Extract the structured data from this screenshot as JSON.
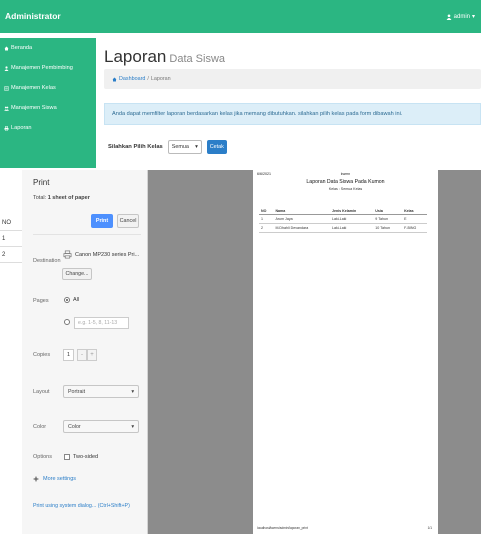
{
  "navbar": {
    "brand": "Administrator",
    "user": "admin",
    "bg_color": "#2bb682"
  },
  "sidebar": {
    "items": [
      {
        "label": "Beranda",
        "icon": "home-icon"
      },
      {
        "label": "Manajemen Pembimbing",
        "icon": "user-icon"
      },
      {
        "label": "Manajemen Kelas",
        "icon": "list-icon"
      },
      {
        "label": "Manajemen Siswa",
        "icon": "users-icon"
      },
      {
        "label": "Laporan",
        "icon": "print-icon"
      }
    ]
  },
  "main": {
    "title": "Laporan",
    "subtitle": "Data Siswa",
    "breadcrumb": {
      "home": "Dashboard",
      "separator": "/",
      "current": "Laporan"
    },
    "alert": "Anda dapat memfilter laporan berdasarkan kelas jika memang dibutuhkan. silahkan pilih kelas pada form dibawah ini.",
    "filter": {
      "label": "Silahkan Pilih Kelas",
      "selected": "Semua",
      "button": "Cetak"
    }
  },
  "background_table": {
    "header": "NO",
    "rows": [
      "1",
      "2"
    ]
  },
  "print": {
    "title": "Print",
    "total_prefix": "Total:",
    "total_value": "1 sheet of paper",
    "print_button": "Print",
    "cancel_button": "Cancel",
    "destination_label": "Destination",
    "destination_value": "Canon MP230 series Pri...",
    "change_button": "Change...",
    "pages_label": "Pages",
    "pages_all": "All",
    "pages_placeholder": "e.g. 1-5, 8, 11-13",
    "copies_label": "Copies",
    "copies_value": "1",
    "copies_minus": "-",
    "copies_plus": "+",
    "layout_label": "Layout",
    "layout_value": "Portrait",
    "color_label": "Color",
    "color_value": "Color",
    "options_label": "Options",
    "two_sided": "Two-sided",
    "more_settings": "More settings",
    "system_dialog": "Print using system dialog... (Ctrl+Shift+P)",
    "accent_color": "#4d90fe"
  },
  "preview": {
    "date": "6/6/2021",
    "header_center": "kwmn",
    "title": "Laporan Data Siswa Pada Kumon",
    "subtitle": "Kelas : Semua Kelas",
    "columns": [
      "NO",
      "Nama",
      "Jenis Kelamin",
      "Usia",
      "Kelas"
    ],
    "rows": [
      [
        "1",
        "Arum Jaya",
        "Laki-Laki",
        "9 Tahun",
        "E"
      ],
      [
        "2",
        "M.Dhahli Devandara",
        "Laki-Laki",
        "10 Tahun",
        "F-BING"
      ]
    ],
    "footer_url": "localhost/kwmn/admin/laporan_print",
    "page_number": "1/1"
  }
}
